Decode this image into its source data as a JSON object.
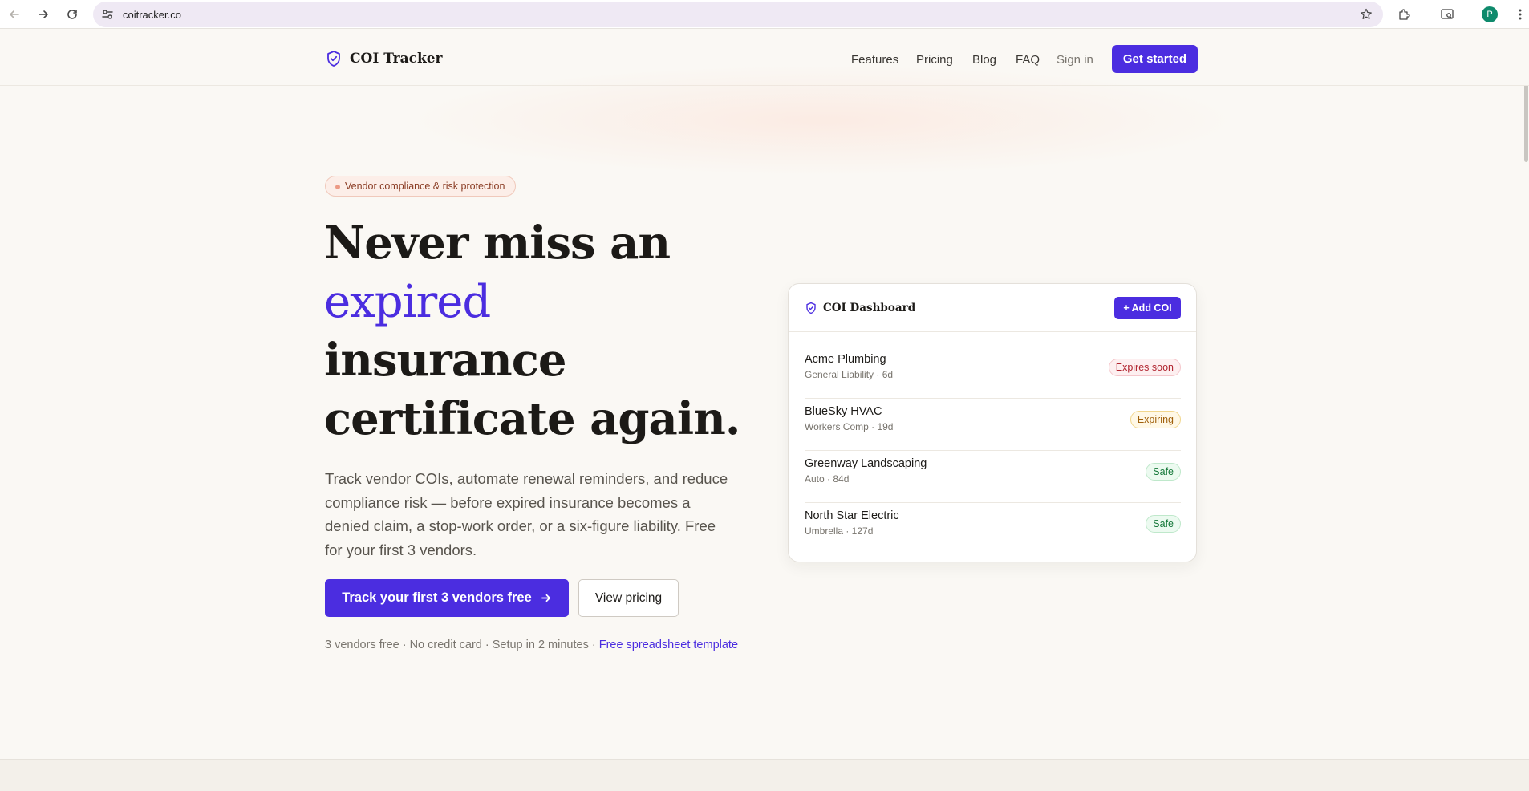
{
  "browser": {
    "url": "coitracker.co",
    "profile_initial": "P"
  },
  "header": {
    "logo_text": "COI Tracker",
    "nav": [
      "Features",
      "Pricing",
      "Blog",
      "FAQ",
      "Sign in"
    ],
    "cta": "Get started"
  },
  "hero": {
    "pill": "Vendor compliance & risk protection",
    "title_line1": "Never miss an",
    "title_accent": "expired",
    "title_line3": "insurance",
    "title_line4": "certificate again.",
    "description": "Track vendor COIs, automate renewal reminders, and reduce compliance risk — before expired insurance becomes a denied claim, a stop-work order, or a six-figure liability. Free for your first 3 vendors.",
    "primary_cta": "Track your first 3 vendors free",
    "secondary_cta": "View pricing",
    "fineprint": "3 vendors free · No credit card · Setup in 2 minutes · ",
    "fineprint_link": "Free spreadsheet template"
  },
  "dashboard": {
    "title": "COI Dashboard",
    "add_button": "+ Add COI",
    "rows": [
      {
        "name": "Acme Plumbing",
        "meta": "General Liability · 6d",
        "status": "Expires soon"
      },
      {
        "name": "BlueSky HVAC",
        "meta": "Workers Comp · 19d",
        "status": "Expiring"
      },
      {
        "name": "Greenway Landscaping",
        "meta": "Auto · 84d",
        "status": "Safe"
      },
      {
        "name": "North Star Electric",
        "meta": "Umbrella · 127d",
        "status": "Safe"
      }
    ]
  },
  "colors": {
    "accent": "#4b2de0",
    "danger": "#b1242f",
    "warning": "#a0600b",
    "success": "#17793b"
  }
}
